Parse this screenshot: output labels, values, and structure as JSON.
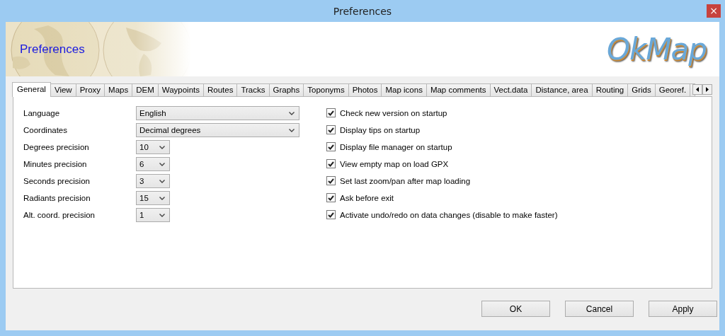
{
  "window": {
    "title": "Preferences",
    "close": "×"
  },
  "banner": {
    "title": "Preferences",
    "logo": "OkMap"
  },
  "tabs": [
    {
      "label": "General",
      "selected": true
    },
    {
      "label": "View",
      "selected": false
    },
    {
      "label": "Proxy",
      "selected": false
    },
    {
      "label": "Maps",
      "selected": false
    },
    {
      "label": "DEM",
      "selected": false
    },
    {
      "label": "Waypoints",
      "selected": false
    },
    {
      "label": "Routes",
      "selected": false
    },
    {
      "label": "Tracks",
      "selected": false
    },
    {
      "label": "Graphs",
      "selected": false
    },
    {
      "label": "Toponyms",
      "selected": false
    },
    {
      "label": "Photos",
      "selected": false
    },
    {
      "label": "Map icons",
      "selected": false
    },
    {
      "label": "Map comments",
      "selected": false
    },
    {
      "label": "Vect.data",
      "selected": false
    },
    {
      "label": "Distance, area",
      "selected": false
    },
    {
      "label": "Routing",
      "selected": false
    },
    {
      "label": "Grids",
      "selected": false
    },
    {
      "label": "Georef.",
      "selected": false
    }
  ],
  "fields": [
    {
      "label": "Language",
      "value": "English",
      "kind": "wide"
    },
    {
      "label": "Coordinates",
      "value": "Decimal degrees",
      "kind": "wide"
    },
    {
      "label": "Degrees precision",
      "value": "10",
      "kind": "narrow"
    },
    {
      "label": "Minutes precision",
      "value": "6",
      "kind": "narrow"
    },
    {
      "label": "Seconds precision",
      "value": "3",
      "kind": "narrow"
    },
    {
      "label": "Radiants precision",
      "value": "15",
      "kind": "narrow"
    },
    {
      "label": "Alt. coord. precision",
      "value": "1",
      "kind": "narrow"
    }
  ],
  "options": [
    {
      "label": "Check new version on startup",
      "checked": true
    },
    {
      "label": "Display tips on startup",
      "checked": true
    },
    {
      "label": "Display file manager on startup",
      "checked": true
    },
    {
      "label": "View empty map on load GPX",
      "checked": true
    },
    {
      "label": "Set last zoom/pan after map loading",
      "checked": true
    },
    {
      "label": "Ask before exit",
      "checked": true
    },
    {
      "label": "Activate undo/redo on data changes (disable to make faster)",
      "checked": true
    }
  ],
  "buttons": [
    "OK",
    "Cancel",
    "Apply"
  ]
}
